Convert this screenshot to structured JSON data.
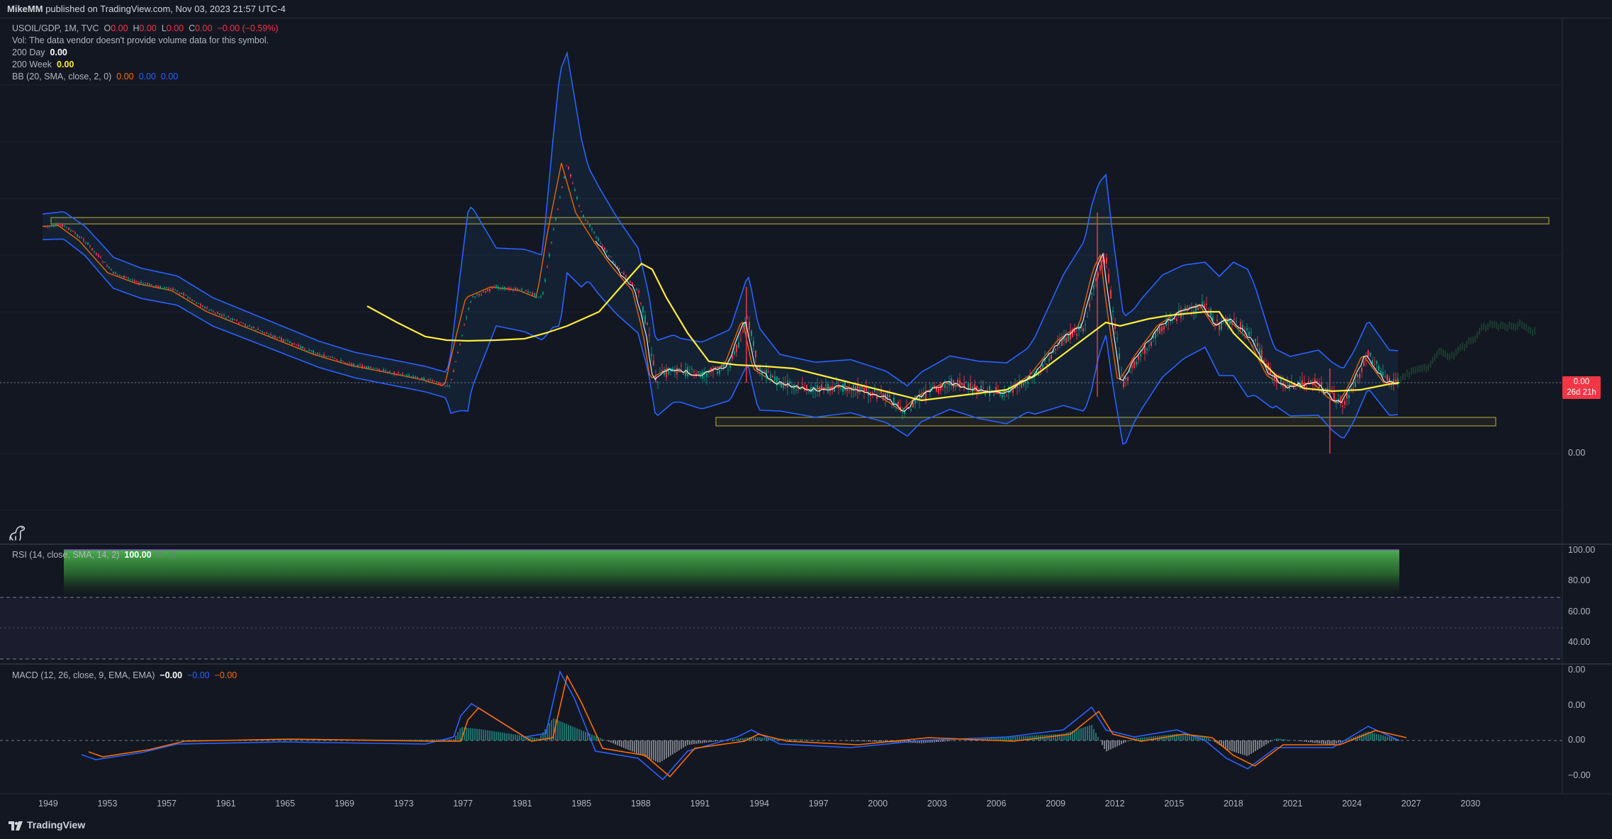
{
  "header": {
    "author": "MikeMM",
    "published": "published on TradingView.com, Nov 03, 2023 21:57 UTC-4"
  },
  "legend": {
    "symbol": "USOIL/GDP, 1M, TVC",
    "o_label": "O",
    "o_value": "0.00",
    "h_label": "H",
    "h_value": "0.00",
    "l_label": "L",
    "l_value": "0.00",
    "c_label": "C",
    "c_value": "0.00",
    "change": "−0.00 (−0.59%)",
    "vol_text": "Vol: The data vendor doesn't provide volume data for this symbol.",
    "ma200d_label": "200 Day",
    "ma200d_value": "0.00",
    "ma200w_label": "200 Week",
    "ma200w_value": "0.00",
    "bb_label": "BB (20, SMA, close, 2, 0)",
    "bb_v1": "0.00",
    "bb_v2": "0.00",
    "bb_v3": "0.00"
  },
  "price_axis": {
    "zero_label": "0.00",
    "tag_value": "0.00",
    "tag_countdown": "26d 21h"
  },
  "rsi": {
    "label": "RSI (14, close, SMA, 14, 2)",
    "value": "100.00",
    "na1": "∅",
    "na2": "∅",
    "ticks": [
      "100.00",
      "80.00",
      "60.00",
      "40.00"
    ]
  },
  "macd": {
    "label": "MACD (12, 26, close, 9, EMA, EMA)",
    "v1": "−0.00",
    "v2": "−0.00",
    "v3": "−0.00",
    "ticks": [
      "0.00",
      "0.00",
      "0.00",
      "−0.00"
    ]
  },
  "time_axis": [
    "1949",
    "1953",
    "1957",
    "1961",
    "1965",
    "1969",
    "1973",
    "1977",
    "1981",
    "1985",
    "1988",
    "1991",
    "1994",
    "1997",
    "2000",
    "2003",
    "2006",
    "2009",
    "2012",
    "2015",
    "2018",
    "2021",
    "2024",
    "2027",
    "2030"
  ],
  "footer": {
    "brand": "TradingView"
  },
  "colors": {
    "background": "#131722",
    "bb_band": "#2962ff",
    "ma_yellow": "#ffeb3b",
    "ma_orange": "#ff6d00",
    "price_white": "#ffffff",
    "rsi_green": "#4caf50",
    "down_red": "#f23645",
    "up_green": "#089981"
  }
}
